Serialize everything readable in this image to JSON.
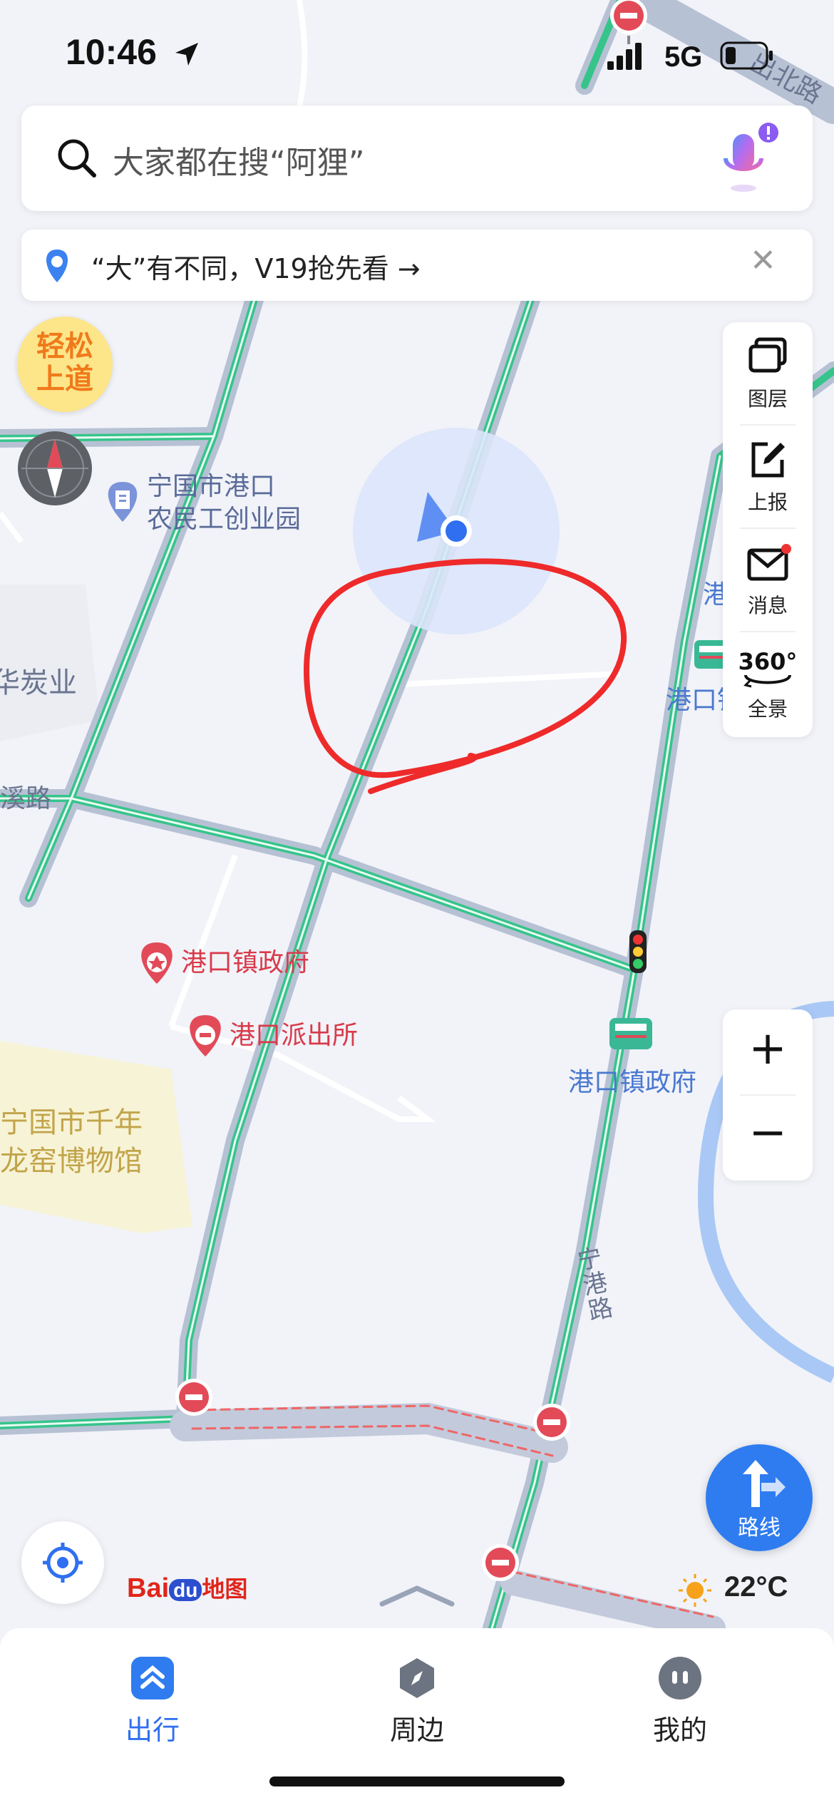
{
  "status_bar": {
    "time": "10:46",
    "network": "5G"
  },
  "search": {
    "placeholder": "大家都在搜“阿狸”"
  },
  "banner": {
    "text": "“大”有不同，V19抢先看 →"
  },
  "easy_road_badge": {
    "line1": "轻松",
    "line2": "上道"
  },
  "side_panel": {
    "items": [
      {
        "label": "图层",
        "icon": "layers-icon"
      },
      {
        "label": "上报",
        "icon": "report-icon"
      },
      {
        "label": "消息",
        "icon": "mail-icon"
      },
      {
        "label": "全景",
        "icon": "panorama-360-icon",
        "badge": "360°"
      }
    ]
  },
  "zoom": {
    "in": "+",
    "out": "−"
  },
  "map_labels": {
    "poi_park": "宁国市港口\n农民工创业园",
    "poi_town_gov": "港口镇政府",
    "poi_police": "港口派出所",
    "museum": "宁国市千年\n龙窑博物馆",
    "left_edge_1": "华炭业",
    "left_edge_2": "溪路",
    "road_north": "出北路",
    "road_ninggang": "宁\n港\n路",
    "bus_stop_1": "港口镇政府",
    "bus_stop_2a": "港",
    "bus_stop_2b": "港口镇"
  },
  "route_button": {
    "label": "路线"
  },
  "brand": {
    "logo_text_a": "Bai",
    "logo_text_b": "du",
    "logo_text_c": "地图"
  },
  "weather": {
    "temp": "22°C"
  },
  "bottom_nav": [
    {
      "label": "出行",
      "icon": "travel-icon",
      "active": true
    },
    {
      "label": "周边",
      "icon": "compass-nearby-icon",
      "active": false
    },
    {
      "label": "我的",
      "icon": "profile-icon",
      "active": false
    }
  ],
  "colors": {
    "accent": "#2f6ff0",
    "route_green": "#36c48a",
    "poi_red": "#e24a58",
    "annotation_red": "#ee2a2a"
  }
}
